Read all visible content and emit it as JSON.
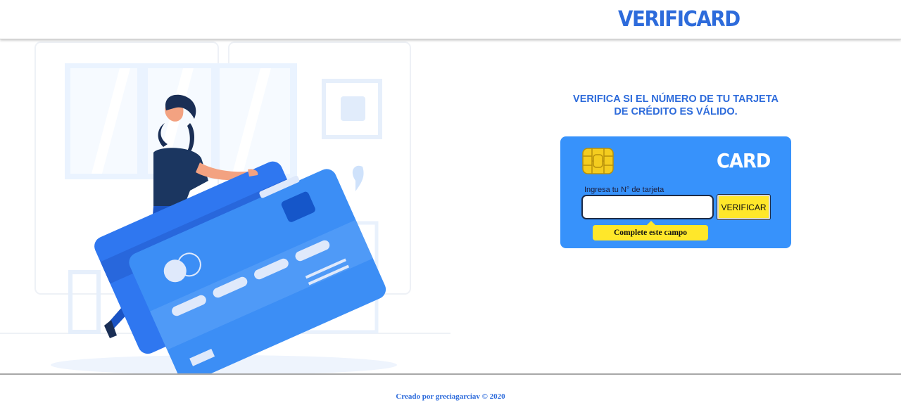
{
  "colors": {
    "accent": "#2d6bdb",
    "card": "#3792fb",
    "yellow": "#ffe72a"
  },
  "header": {
    "brand": "VERIFICARD"
  },
  "main": {
    "title_line1": "VERIFICA SI EL NÚMERO DE TU TARJETA",
    "title_line2": "DE CRÉDITO ES VÁLIDO."
  },
  "card": {
    "label": "CARD",
    "chip_icon": "sim-chip-icon",
    "field_label": "Ingresa tu N° de tarjeta",
    "input_value": "",
    "input_placeholder": "",
    "button_label": "VERIFICAR",
    "validation_message": "Complete este campo"
  },
  "footer": {
    "text": "Creado por greciagarciav © 2020"
  }
}
